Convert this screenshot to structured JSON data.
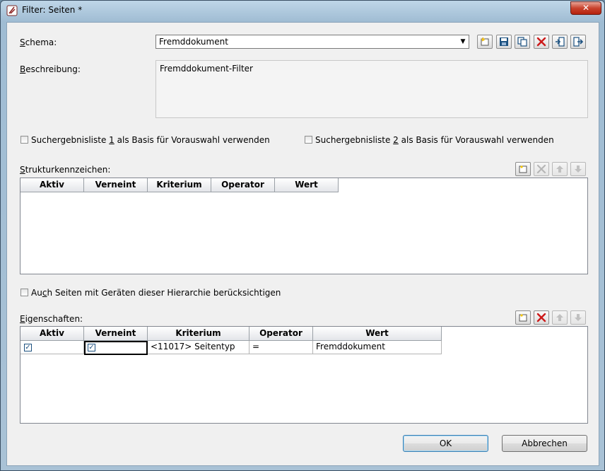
{
  "window": {
    "title": "Filter: Seiten *",
    "close_glyph": "✕"
  },
  "schema": {
    "label_pre": "",
    "label_ul": "S",
    "label_post": "chema:",
    "value": "Fremddokument"
  },
  "beschreibung": {
    "label_pre": "",
    "label_ul": "B",
    "label_post": "eschreibung:",
    "value": "Fremddokument-Filter"
  },
  "options": {
    "opt1": {
      "pre": "Suchergebnisliste ",
      "ul": "1",
      "post": " als Basis für Vorauswahl verwenden",
      "checked": false
    },
    "opt2": {
      "pre": "Suchergebnisliste ",
      "ul": "2",
      "post": " als Basis für Vorauswahl verwenden",
      "checked": false
    },
    "hierarchy": {
      "pre": "Au",
      "ul": "c",
      "post": "h Seiten mit Geräten dieser Hierarchie berücksichtigen",
      "checked": false
    }
  },
  "struktur": {
    "label_pre": "",
    "label_ul": "S",
    "label_post": "trukturkennzeichen:",
    "columns": [
      "Aktiv",
      "Verneint",
      "Kriterium",
      "Operator",
      "Wert"
    ]
  },
  "eigenschaften": {
    "label_pre": "",
    "label_ul": "E",
    "label_post": "igenschaften:",
    "columns": [
      "Aktiv",
      "Verneint",
      "Kriterium",
      "Operator",
      "Wert"
    ],
    "rows": [
      {
        "aktiv": true,
        "verneint": true,
        "kriterium": "<11017> Seitentyp",
        "operator": "=",
        "wert": "Fremddokument"
      }
    ]
  },
  "buttons": {
    "ok": "OK",
    "cancel": "Abbrechen"
  },
  "icons": {
    "schema_toolbar": [
      "new-icon",
      "save-icon",
      "copy-icon",
      "delete-icon",
      "import-icon",
      "export-icon"
    ],
    "grid_toolbar": [
      "new-icon",
      "delete-icon",
      "move-up-icon",
      "move-down-icon"
    ]
  },
  "colors": {
    "delete_red": "#cc1a1a",
    "accent_blue": "#1c5180"
  }
}
